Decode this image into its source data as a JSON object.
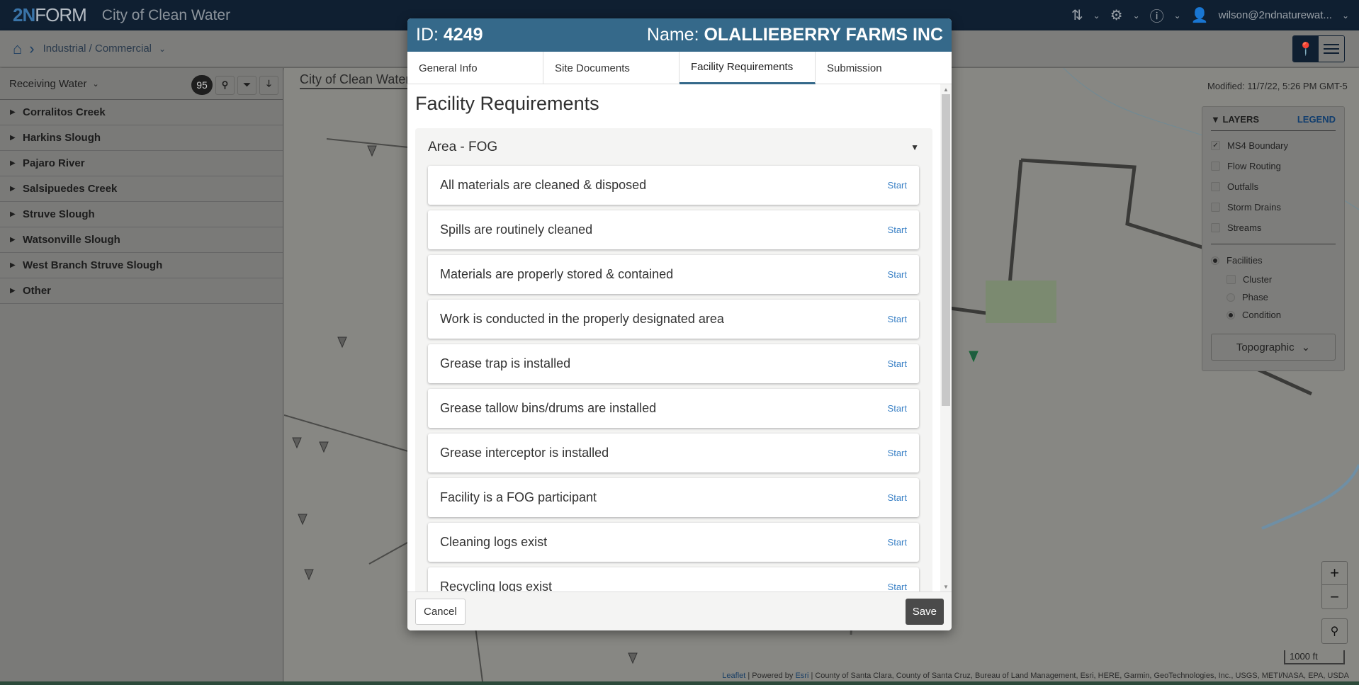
{
  "topbar": {
    "logo_num": "2N",
    "logo_text": "FORM",
    "app_title": "City of Clean Water",
    "user": "wilson@2ndnaturewat...",
    "icons": [
      "sort-icon",
      "gear-icon",
      "help-icon",
      "user-icon"
    ]
  },
  "subbar": {
    "breadcrumb": "Industrial / Commercial"
  },
  "sidebar": {
    "title": "Receiving Water",
    "count": "95",
    "items": [
      {
        "label": "Corralitos Creek"
      },
      {
        "label": "Harkins Slough"
      },
      {
        "label": "Pajaro River"
      },
      {
        "label": "Salsipuedes Creek"
      },
      {
        "label": "Struve Slough"
      },
      {
        "label": "Watsonville Slough"
      },
      {
        "label": "West Branch Struve Slough"
      },
      {
        "label": "Other"
      }
    ]
  },
  "map": {
    "title": "City of Clean Water",
    "modified": "Modified: 11/7/22, 5:26 PM GMT-5",
    "layers": {
      "header": "LAYERS",
      "legend_link": "LEGEND",
      "checkboxes": [
        {
          "label": "MS4 Boundary",
          "checked": true
        },
        {
          "label": "Flow Routing",
          "checked": false
        },
        {
          "label": "Outfalls",
          "checked": false
        },
        {
          "label": "Storm Drains",
          "checked": false
        },
        {
          "label": "Streams",
          "checked": false
        }
      ],
      "facilities_label": "Facilities",
      "facility_options": [
        {
          "label": "Cluster",
          "type": "checkbox",
          "selected": false
        },
        {
          "label": "Phase",
          "type": "radio",
          "selected": false
        },
        {
          "label": "Condition",
          "type": "radio",
          "selected": true
        }
      ],
      "basemap": "Topographic"
    },
    "zoom_in": "+",
    "zoom_out": "−",
    "scale": "1000 ft",
    "attribution_leaflet": "Leaflet",
    "attribution_powered": " | Powered by ",
    "attribution_esri": "Esri",
    "attribution_rest": " | County of Santa Clara, County of Santa Cruz, Bureau of Land Management, Esri, HERE, Garmin, GeoTechnologies, Inc., USGS, METI/NASA, EPA, USDA"
  },
  "modal": {
    "id_label": "ID: ",
    "id_value": "4249",
    "name_label": "Name: ",
    "name_value": "OLALLIEBERRY FARMS INC",
    "tabs": [
      {
        "label": "General Info",
        "active": false
      },
      {
        "label": "Site Documents",
        "active": false
      },
      {
        "label": "Facility Requirements",
        "active": true
      },
      {
        "label": "Submission",
        "active": false
      }
    ],
    "section_title": "Facility Requirements",
    "area_title": "Area - FOG",
    "requirements": [
      {
        "label": "All materials are cleaned & disposed",
        "action": "Start"
      },
      {
        "label": "Spills are routinely cleaned",
        "action": "Start"
      },
      {
        "label": "Materials are properly stored & contained",
        "action": "Start"
      },
      {
        "label": "Work is conducted in the properly designated area",
        "action": "Start"
      },
      {
        "label": "Grease trap is installed",
        "action": "Start"
      },
      {
        "label": "Grease tallow bins/drums are installed",
        "action": "Start"
      },
      {
        "label": "Grease interceptor is installed",
        "action": "Start"
      },
      {
        "label": "Facility is a FOG participant",
        "action": "Start"
      },
      {
        "label": "Cleaning logs exist",
        "action": "Start"
      },
      {
        "label": "Recycling logs exist",
        "action": "Start"
      }
    ],
    "cancel_label": "Cancel",
    "save_label": "Save"
  }
}
